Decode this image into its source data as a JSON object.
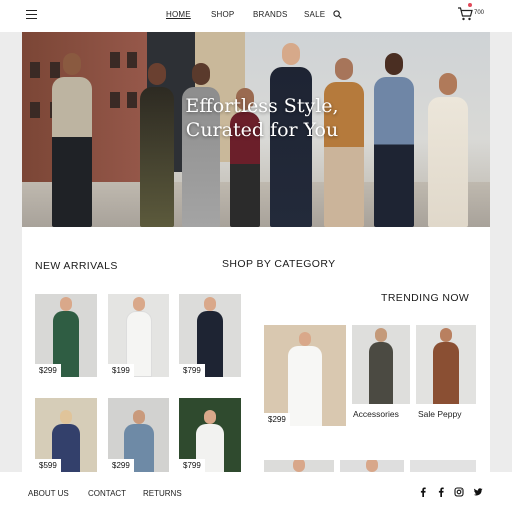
{
  "nav": {
    "home": "HOME",
    "shop": "SHOP",
    "brands": "BRANDS",
    "sale": "SALE",
    "cart_count": "700"
  },
  "hero": {
    "title_line1": "Effortless Style,",
    "title_line2": "Curated for You"
  },
  "sections": {
    "new_arrivals": "NEW ARRIVALS",
    "shop_by_category": "SHOP BY CATEGORY",
    "trending_now": "TRENDING NOW"
  },
  "new_arrivals": [
    {
      "price": "$299"
    },
    {
      "price": "$199"
    },
    {
      "price": "$799"
    },
    {
      "price": "$599"
    },
    {
      "price": "$299"
    },
    {
      "price": "$799"
    }
  ],
  "trending": [
    {
      "price": "$299"
    },
    {
      "label": "Accessories"
    },
    {
      "label": "Sale Peppy"
    }
  ],
  "footer": {
    "about": "ABOUT US",
    "contact": "CONTACT",
    "returns": "RETURNS"
  },
  "colors": {
    "accent_dot": "#e14a5a",
    "page_bg": "#ececec"
  }
}
